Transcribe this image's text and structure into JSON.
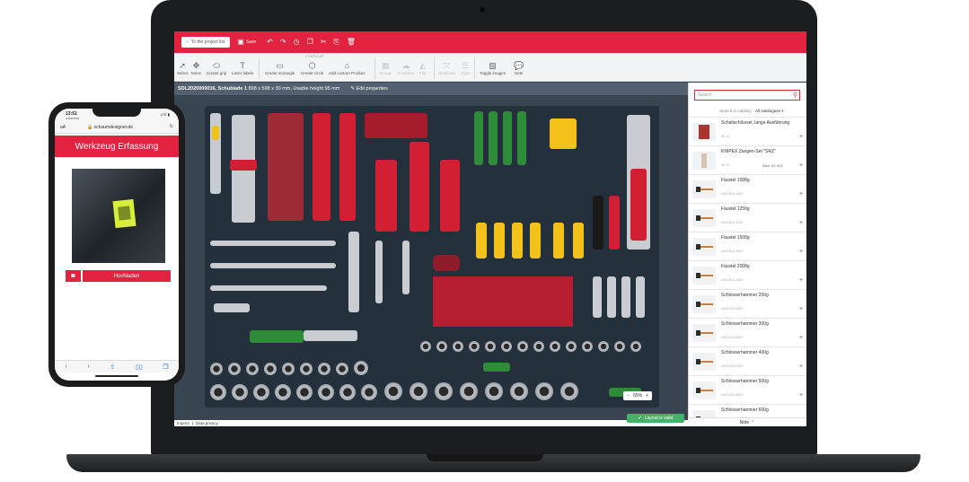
{
  "editor": {
    "topbar": {
      "back_label": "To the project list",
      "save_label": "Save"
    },
    "toolbar": {
      "contour_group_label": "CONTOUR",
      "tools": [
        {
          "label": "Select",
          "icon": "cursor-icon"
        },
        {
          "label": "Move",
          "icon": "move-icon"
        },
        {
          "label": "Create grip",
          "icon": "grip-icon"
        },
        {
          "label": "Laser labels",
          "icon": "text-icon"
        },
        {
          "label": "Create rectangle",
          "icon": "rectangle-icon"
        },
        {
          "label": "Create circle",
          "icon": "circle-icon"
        },
        {
          "label": "Add custom Product",
          "icon": "custom-product-icon"
        },
        {
          "label": "Group",
          "icon": "group-icon"
        },
        {
          "label": "Combine",
          "icon": "combine-icon"
        },
        {
          "label": "Flip",
          "icon": "flip-icon"
        },
        {
          "label": "Distribute",
          "icon": "distribute-icon"
        },
        {
          "label": "Align",
          "icon": "align-icon"
        },
        {
          "label": "Toggle images",
          "icon": "image-icon"
        },
        {
          "label": "Note",
          "icon": "note-icon"
        }
      ]
    },
    "subheader": {
      "drawer_id": "SDL2020000016, Schublade 1",
      "dimensions": "898 x 598 x 30 mm, Usable height 95 mm",
      "edit_label": "Edit properties"
    },
    "zoom": {
      "value": "65%",
      "minus": "−",
      "plus": "+"
    },
    "footer": {
      "imprint": "Imprint",
      "privacy": "Data privacy",
      "separator": "|"
    },
    "valid_label": "Layout is valid",
    "panel": {
      "search_placeholder": "Search",
      "catalog_label": "Search in catalog:",
      "catalog_value": "All catalogues",
      "note_label": "Note",
      "products": [
        {
          "name": "Schaltschlüssel, lange Ausführung",
          "sku": "90 11",
          "size": ""
        },
        {
          "name": "KNIPEX Zangen-Set \"SRZ\"",
          "sku": "90 20",
          "size": "Size: 01 V02"
        },
        {
          "name": "Fäustel 1000g",
          "sku": "0000401-1000",
          "size": ""
        },
        {
          "name": "Fäustel 1250g",
          "sku": "0000401-1250",
          "size": ""
        },
        {
          "name": "Fäustel 1500g",
          "sku": "0000401-1500",
          "size": ""
        },
        {
          "name": "Fäustel 2000g",
          "sku": "0000401-2000",
          "size": ""
        },
        {
          "name": "Schlosserhammer 200g",
          "sku": "0001202-0200",
          "size": ""
        },
        {
          "name": "Schlosserhammer 300g",
          "sku": "0001202-0300",
          "size": ""
        },
        {
          "name": "Schlosserhammer 400g",
          "sku": "0001202-0400",
          "size": ""
        },
        {
          "name": "Schlosserhammer 500g",
          "sku": "0001202-0500",
          "size": ""
        },
        {
          "name": "Schlosserhammer 600g",
          "sku": "",
          "size": ""
        }
      ]
    }
  },
  "phone": {
    "time": "13:51",
    "carrier": "◂ Kamera",
    "status_right": "LTE ▮",
    "text_size": "aA",
    "url": "schaumdesigner.de",
    "reload": "↻",
    "app_title": "Werkzeug Erfassung",
    "upload_label": "Hochladen",
    "nav_icons": [
      "‹",
      "›",
      "⇧",
      "▯▯",
      "❐"
    ]
  },
  "colors": {
    "brand_red": "#e2233f",
    "valid_green": "#44b36a",
    "canvas_bg": "#3a4552"
  }
}
